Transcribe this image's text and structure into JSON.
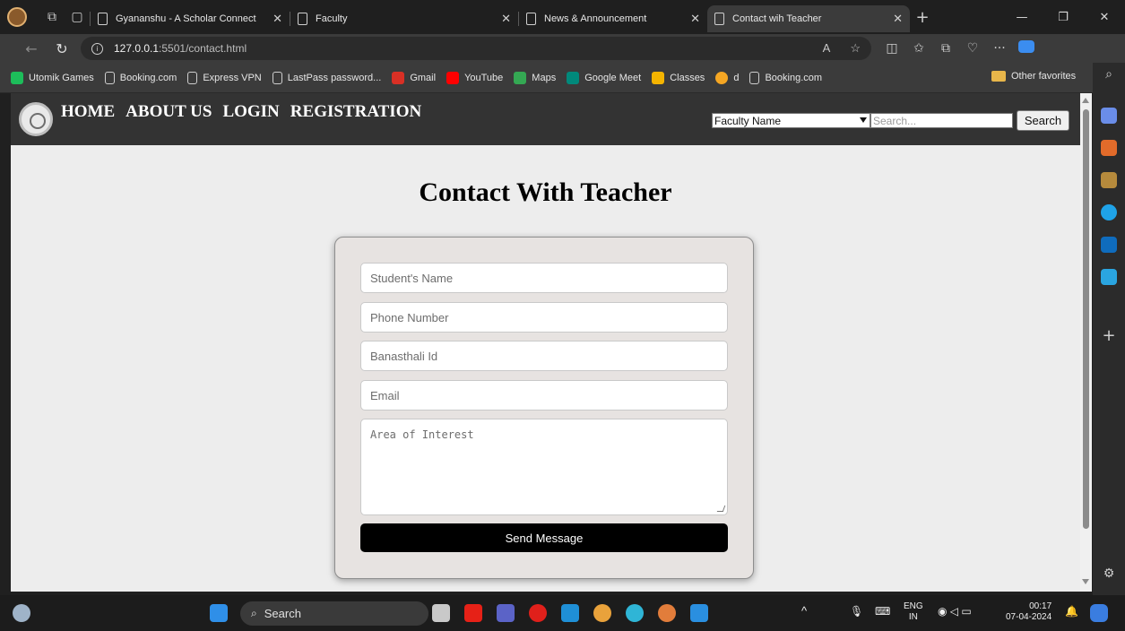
{
  "browser": {
    "tabs": [
      {
        "title": "Gyananshu - A Scholar Connect"
      },
      {
        "title": "Faculty"
      },
      {
        "title": "News & Announcement"
      },
      {
        "title": "Contact wih Teacher",
        "active": true
      }
    ],
    "url": {
      "host": "127.0.0.1",
      "rest": ":5501/contact.html"
    },
    "favorites": [
      "Utomik Games",
      "Booking.com",
      "Express VPN",
      "LastPass password...",
      "Gmail",
      "YouTube",
      "Maps",
      "Google Meet",
      "Classes",
      "d",
      "Booking.com"
    ],
    "other_favorites": "Other favorites"
  },
  "site": {
    "nav": [
      "HOME",
      "ABOUT US",
      "LOGIN",
      "REGISTRATION"
    ],
    "search": {
      "select_value": "Faculty Name",
      "placeholder": "Search...",
      "button": "Search"
    }
  },
  "page": {
    "title": "Contact With Teacher",
    "form": {
      "name_placeholder": "Student's Name",
      "phone_placeholder": "Phone Number",
      "id_placeholder": "Banasthali Id",
      "email_placeholder": "Email",
      "interest_placeholder": "Area of Interest",
      "submit": "Send Message"
    }
  },
  "taskbar": {
    "search": "Search",
    "lang": "ENG",
    "region": "IN",
    "time": "00:17",
    "date": "07-04-2024"
  }
}
